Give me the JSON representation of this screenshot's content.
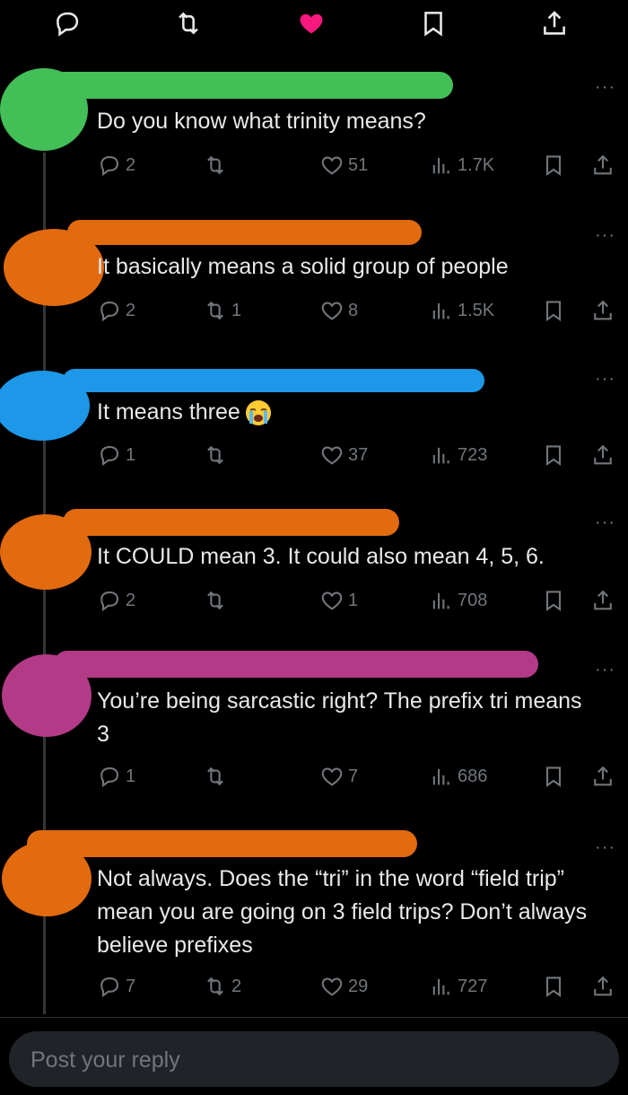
{
  "colors": {
    "green": "#43bf58",
    "orange": "#e26a0f",
    "blue": "#1d97e8",
    "magenta": "#b23a87",
    "like_pink": "#f91880",
    "muted": "#71767b",
    "text": "#e7e9ea"
  },
  "top_actions": [
    "reply-icon",
    "repost-icon",
    "like-filled-icon",
    "bookmark-icon",
    "share-icon"
  ],
  "replies": [
    {
      "text": "Do you know what trinity means?",
      "replies": "2",
      "reposts": "",
      "likes": "51",
      "views": "1.7K",
      "scribble": "green"
    },
    {
      "text": "It basically means a solid group of people",
      "replies": "2",
      "reposts": "1",
      "likes": "8",
      "views": "1.5K",
      "scribble": "orange"
    },
    {
      "text": "It means three",
      "emoji": "loudly-crying-face-emoji",
      "replies": "1",
      "reposts": "",
      "likes": "37",
      "views": "723",
      "scribble": "blue"
    },
    {
      "text": "It COULD mean 3. It could also mean 4, 5, 6.",
      "replies": "2",
      "reposts": "",
      "likes": "1",
      "views": "708",
      "scribble": "orange"
    },
    {
      "text": "You’re being sarcastic right? The prefix tri means 3",
      "replies": "1",
      "reposts": "",
      "likes": "7",
      "views": "686",
      "scribble": "magenta"
    },
    {
      "text": "Not always. Does the “tri” in the word “field trip” mean you are going on 3 field trips? Don’t always believe prefixes",
      "replies": "7",
      "reposts": "2",
      "likes": "29",
      "views": "727",
      "scribble": "orange"
    }
  ],
  "more_label": "···",
  "reply_input": {
    "placeholder": "Post your reply",
    "value": ""
  }
}
